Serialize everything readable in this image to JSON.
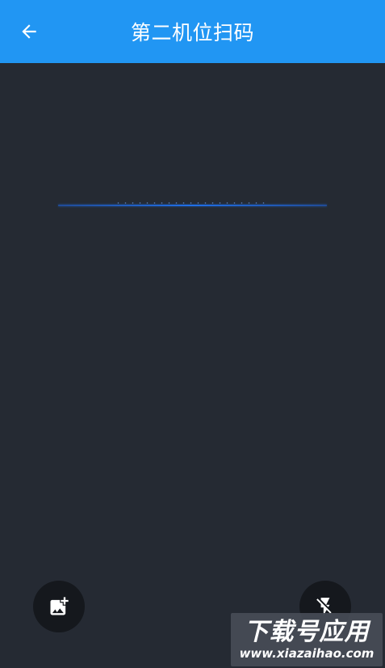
{
  "header": {
    "title": "第二机位扫码",
    "back_icon": "arrow-left-icon"
  },
  "colors": {
    "topbar": "#2196f3",
    "background": "#252a33",
    "scan_line": "#1f6fe8",
    "button_bg": "#15181d"
  },
  "controls": {
    "gallery_icon": "add-photo-icon",
    "flash_icon": "flash-off-icon"
  },
  "watermark": {
    "title": "下载号应用",
    "url": "www.xiazaihao.com"
  }
}
